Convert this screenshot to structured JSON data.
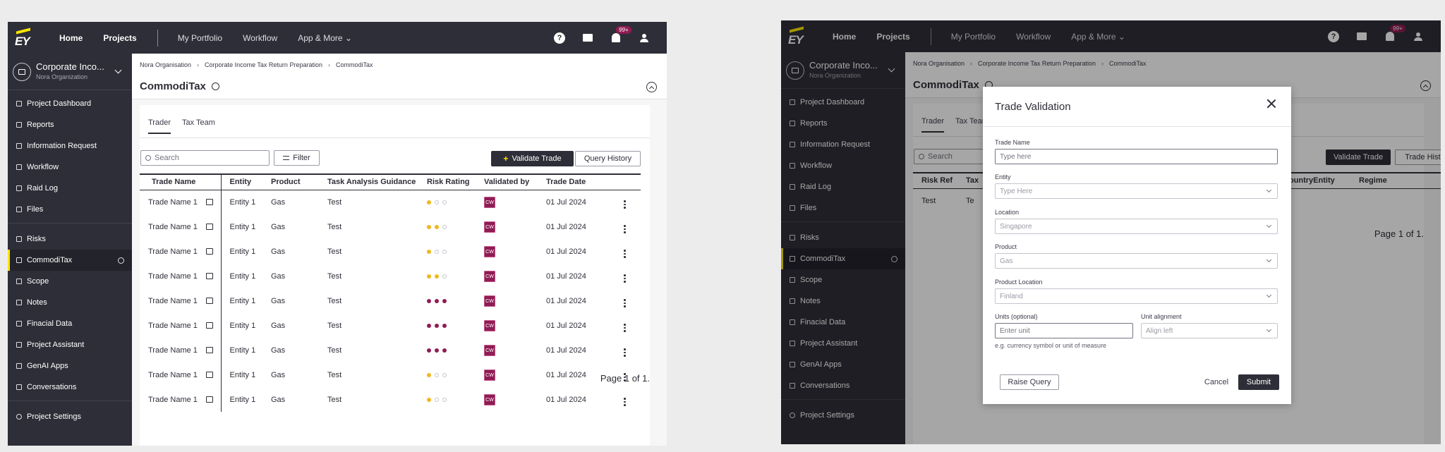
{
  "nav": {
    "logo": "EY",
    "home": "Home",
    "projects": "Projects",
    "portfolio": "My Portfolio",
    "workflow": "Workflow",
    "appmore": "App & More",
    "help": "?",
    "notif_badge": "99+"
  },
  "project": {
    "name": "Corporate Inco...",
    "org": "Nora Organization"
  },
  "sidebar": {
    "items": [
      {
        "label": "Project Dashboard"
      },
      {
        "label": "Reports"
      },
      {
        "label": "Information Request"
      },
      {
        "label": "Workflow"
      },
      {
        "label": "Raid Log"
      },
      {
        "label": "Files"
      }
    ],
    "items2": [
      {
        "label": "Risks"
      },
      {
        "label": "CommodiTax"
      },
      {
        "label": "Scope"
      },
      {
        "label": "Notes"
      },
      {
        "label": "Finacial Data"
      },
      {
        "label": "Project Assistant"
      },
      {
        "label": "GenAI Apps"
      },
      {
        "label": "Conversations"
      }
    ],
    "settings": "Project Settings"
  },
  "breadcrumb": [
    "Nora Organisation",
    "Corporate Income Tax Return Preparation",
    "CommodiTax"
  ],
  "page_title": "CommodiTax",
  "tabs": [
    "Trader",
    "Tax Team"
  ],
  "toolbar": {
    "search_placeholder": "Search",
    "filter": "Filter",
    "validate": "Validate Trade",
    "query_history": "Query History",
    "trade_history": "Trade History"
  },
  "table": {
    "headers": [
      "Trade Name",
      "Entity",
      "Product",
      "Task Analysis Guidance",
      "Risk Rating",
      "Validated by",
      "Trade Date"
    ],
    "rows": [
      {
        "name": "Trade Name 1",
        "entity": "Entity 1",
        "product": "Gas",
        "guidance": "Test",
        "risk": "low",
        "by": "CW",
        "date": "01 Jul 2024"
      },
      {
        "name": "Trade Name 1",
        "entity": "Entity 1",
        "product": "Gas",
        "guidance": "Test",
        "risk": "medium",
        "by": "CW",
        "date": "01 Jul 2024"
      },
      {
        "name": "Trade Name 1",
        "entity": "Entity 1",
        "product": "Gas",
        "guidance": "Test",
        "risk": "low",
        "by": "CW",
        "date": "01 Jul 2024"
      },
      {
        "name": "Trade Name 1",
        "entity": "Entity 1",
        "product": "Gas",
        "guidance": "Test",
        "risk": "medium",
        "by": "CW",
        "date": "01 Jul 2024"
      },
      {
        "name": "Trade Name 1",
        "entity": "Entity 1",
        "product": "Gas",
        "guidance": "Test",
        "risk": "high",
        "by": "CW",
        "date": "01 Jul 2024"
      },
      {
        "name": "Trade Name 1",
        "entity": "Entity 1",
        "product": "Gas",
        "guidance": "Test",
        "risk": "high",
        "by": "CW",
        "date": "01 Jul 2024"
      },
      {
        "name": "Trade Name 1",
        "entity": "Entity 1",
        "product": "Gas",
        "guidance": "Test",
        "risk": "high",
        "by": "CW",
        "date": "01 Jul 2024"
      },
      {
        "name": "Trade Name 1",
        "entity": "Entity 1",
        "product": "Gas",
        "guidance": "Test",
        "risk": "low",
        "by": "CW",
        "date": "01 Jul 2024"
      },
      {
        "name": "Trade Name 1",
        "entity": "Entity 1",
        "product": "Gas",
        "guidance": "Test",
        "risk": "low",
        "by": "CW",
        "date": "01 Jul 2024"
      }
    ]
  },
  "table2": {
    "headers": [
      "Risk Ref",
      "Tax",
      "CountryEntity",
      "Regime"
    ],
    "row": {
      "ref": "Test",
      "tax": "Te"
    }
  },
  "pager": "Page 1 of 1.",
  "modal": {
    "title": "Trade Validation",
    "trade_name_label": "Trade Name",
    "trade_name_placeholder": "Type here",
    "entity_label": "Entity",
    "entity_value": "Type Here",
    "location_label": "Location",
    "location_value": "Singapore",
    "product_label": "Product",
    "product_value": "Gas",
    "product_location_label": "Product Location",
    "product_location_value": "Finland",
    "units_label": "Units (optional)",
    "units_placeholder": "Enter unit",
    "units_hint": "e.g. currency symbol or unit of measure",
    "alignment_label": "Unit alignment",
    "alignment_value": "Align left",
    "raise_query": "Raise Query",
    "cancel": "Cancel",
    "submit": "Submit"
  },
  "colors": {
    "brand_yellow": "#ffe600",
    "dark": "#2e2e38",
    "maroon": "#8f1c54",
    "amber": "#f1b71c"
  }
}
